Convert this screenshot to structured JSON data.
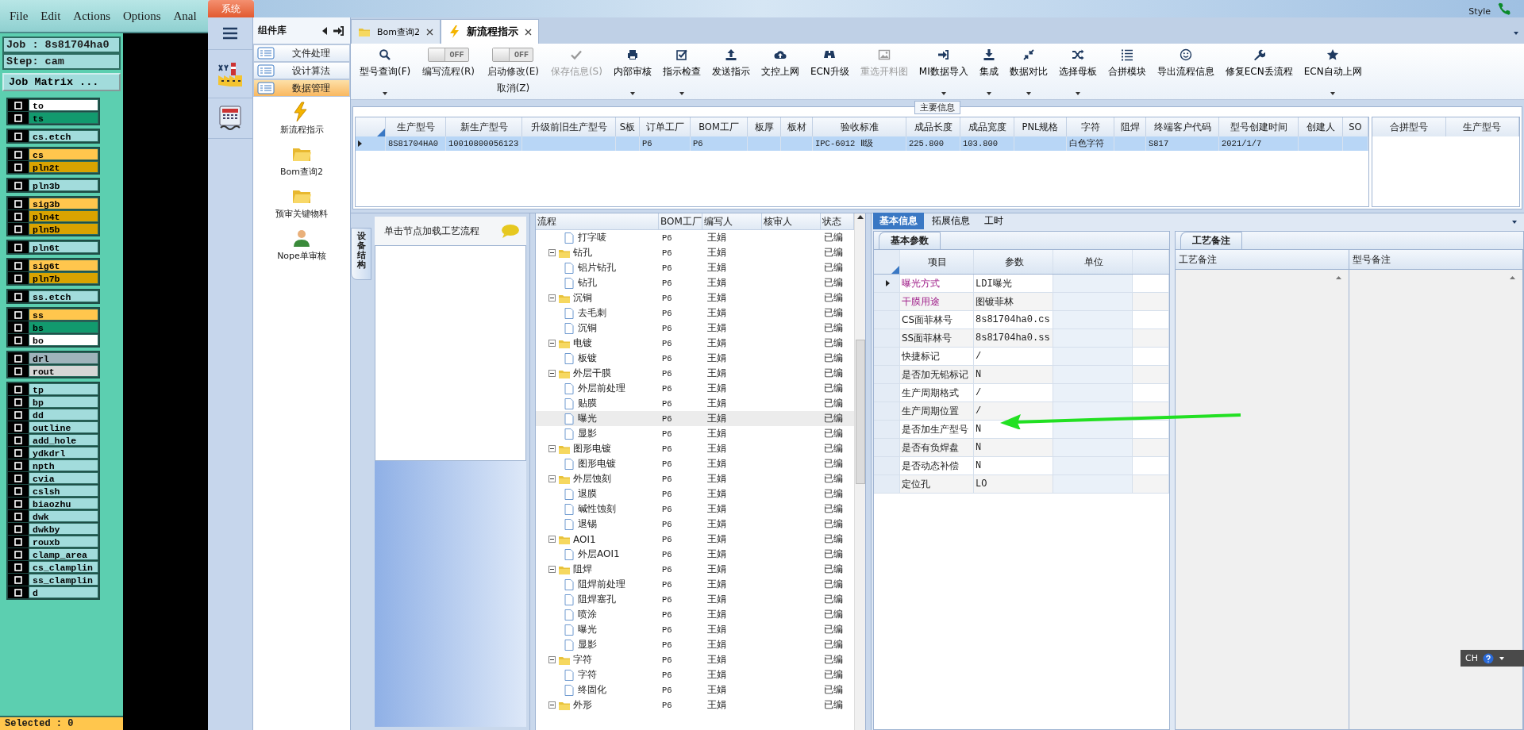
{
  "cam": {
    "menu": [
      "File",
      "Edit",
      "Actions",
      "Options",
      "Anal"
    ],
    "job": "Job : 8s81704ha0",
    "step": "Step: cam",
    "matrix_button": "Job Matrix ...",
    "layer_groups": [
      {
        "layers": [
          {
            "name": "to",
            "color": "#ffffff"
          },
          {
            "name": "ts",
            "color": "#129a6e"
          }
        ]
      },
      {
        "layers": [
          {
            "name": "cs.etch",
            "color": "#a2dcdc"
          }
        ]
      },
      {
        "layers": [
          {
            "name": "cs",
            "color": "#ffc64d"
          },
          {
            "name": "pln2t",
            "color": "#d9a300"
          }
        ]
      },
      {
        "layers": [
          {
            "name": "pln3b",
            "color": "#a2dcdc"
          }
        ]
      },
      {
        "layers": [
          {
            "name": "sig3b",
            "color": "#ffc64d"
          },
          {
            "name": "pln4t",
            "color": "#d9a300"
          },
          {
            "name": "pln5b",
            "color": "#d9a300"
          }
        ]
      },
      {
        "layers": [
          {
            "name": "pln6t",
            "color": "#a2dcdc"
          }
        ]
      },
      {
        "layers": [
          {
            "name": "sig6t",
            "color": "#ffc64d"
          },
          {
            "name": "pln7b",
            "color": "#d9a300"
          }
        ]
      },
      {
        "layers": [
          {
            "name": "ss.etch",
            "color": "#a2dcdc"
          }
        ]
      },
      {
        "layers": [
          {
            "name": "ss",
            "color": "#ffc64d"
          },
          {
            "name": "bs",
            "color": "#129a6e"
          },
          {
            "name": "bo",
            "color": "#ffffff"
          }
        ]
      },
      {
        "layers": [
          {
            "name": "drl",
            "color": "#9fb3bb"
          },
          {
            "name": "rout",
            "color": "#d6d6d6"
          }
        ]
      },
      {
        "layers": [
          {
            "name": "tp",
            "color": "#a2dcdc"
          },
          {
            "name": "bp",
            "color": "#a2dcdc"
          },
          {
            "name": "dd",
            "color": "#a2dcdc"
          },
          {
            "name": "outline",
            "color": "#a2dcdc"
          },
          {
            "name": "add_hole",
            "color": "#a2dcdc"
          },
          {
            "name": "ydkdrl",
            "color": "#a2dcdc"
          },
          {
            "name": "npth",
            "color": "#a2dcdc"
          },
          {
            "name": "cvia",
            "color": "#a2dcdc"
          },
          {
            "name": "cslsh",
            "color": "#a2dcdc"
          },
          {
            "name": "biaozhu",
            "color": "#a2dcdc"
          },
          {
            "name": "dwk",
            "color": "#a2dcdc"
          },
          {
            "name": "dwkby",
            "color": "#a2dcdc"
          },
          {
            "name": "rouxb",
            "color": "#a2dcdc"
          },
          {
            "name": "clamp_area",
            "color": "#a2dcdc"
          },
          {
            "name": "cs_clamplin",
            "color": "#a2dcdc"
          },
          {
            "name": "ss_clamplin",
            "color": "#a2dcdc"
          },
          {
            "name": "d",
            "color": "#a2dcdc"
          }
        ]
      }
    ],
    "status": "Selected : 0"
  },
  "backdrop": {
    "style_menu": "Style"
  },
  "app": {
    "system_tab": "系统",
    "components": {
      "title": "组件库",
      "categories": [
        {
          "label": "文件处理",
          "selected": false
        },
        {
          "label": "设计算法",
          "selected": false
        },
        {
          "label": "数据管理",
          "selected": true
        }
      ],
      "modules": [
        {
          "label": "新流程指示"
        },
        {
          "label": "Bom查询2"
        },
        {
          "label": "预审关键物料"
        },
        {
          "label": "Nope单审核"
        }
      ]
    },
    "tabs": [
      {
        "label": "Bom查询2",
        "selected": false
      },
      {
        "label": "新流程指示",
        "selected": true
      }
    ],
    "toolbar": [
      {
        "kind": "button",
        "label": "型号查询(F)",
        "dropdown": true,
        "disabled": false
      },
      {
        "kind": "toggle",
        "label": "编写流程(R)",
        "state": "OFF",
        "on": false
      },
      {
        "kind": "toggle",
        "label": "启动修改(E)",
        "sublabel": "取消(Z)",
        "state": "OFF",
        "on": false
      },
      {
        "kind": "button",
        "label": "保存信息(S)",
        "dropdown": false,
        "disabled": true
      },
      {
        "kind": "button",
        "label": "内部审核",
        "dropdown": true,
        "disabled": false
      },
      {
        "kind": "button",
        "label": "指示检查",
        "dropdown": true,
        "disabled": false
      },
      {
        "kind": "button",
        "label": "发送指示",
        "dropdown": false,
        "disabled": false
      },
      {
        "kind": "button",
        "label": "文控上网",
        "dropdown": false,
        "disabled": false
      },
      {
        "kind": "button",
        "label": "ECN升级",
        "dropdown": false,
        "disabled": false
      },
      {
        "kind": "button",
        "label": "重选开料图",
        "dropdown": false,
        "disabled": true
      },
      {
        "kind": "button",
        "label": "MI数据导入",
        "dropdown": true,
        "disabled": false
      },
      {
        "kind": "button",
        "label": "集成",
        "dropdown": true,
        "disabled": false
      },
      {
        "kind": "button",
        "label": "数据对比",
        "dropdown": true,
        "disabled": false
      },
      {
        "kind": "button",
        "label": "选择母板",
        "dropdown": true,
        "disabled": false
      },
      {
        "kind": "button",
        "label": "合拼模块",
        "dropdown": false,
        "disabled": false
      },
      {
        "kind": "button",
        "label": "导出流程信息",
        "dropdown": false,
        "disabled": false
      },
      {
        "kind": "button",
        "label": "修复ECN丢流程",
        "dropdown": false,
        "disabled": false
      },
      {
        "kind": "button",
        "label": "ECN自动上网",
        "dropdown": true,
        "disabled": false
      }
    ],
    "main_info": {
      "title": "主要信息",
      "row_selected": true,
      "columns": [
        {
          "label": "生产型号",
          "value": "8S81704HA0"
        },
        {
          "label": "新生产型号",
          "value": "10010800056123"
        },
        {
          "label": "升级前旧生产型号"
        },
        {
          "label": "S板"
        },
        {
          "label": "订单工厂",
          "value": "P6"
        },
        {
          "label": "BOM工厂",
          "value": "P6"
        },
        {
          "label": "板厚"
        },
        {
          "label": "板材"
        },
        {
          "label": "验收标准",
          "value": "IPC-6012 Ⅱ级"
        },
        {
          "label": "成品长度",
          "value": "225.800"
        },
        {
          "label": "成品宽度",
          "value": "103.800"
        },
        {
          "label": "PNL规格"
        },
        {
          "label": "字符",
          "value": "白色字符"
        },
        {
          "label": "阻焊"
        },
        {
          "label": "终端客户代码",
          "value": "S817"
        },
        {
          "label": "型号创建时间",
          "value": "2021/1/7"
        },
        {
          "label": "创建人"
        },
        {
          "label": "SO"
        }
      ],
      "side_columns": [
        "合拼型号",
        "生产型号"
      ]
    },
    "equipment_tab": "设备结构",
    "flow_hint": "单击节点加载工艺流程",
    "flow_tree": {
      "columns": [
        "流程",
        "BOM工厂",
        "编写人",
        "核审人",
        "状态"
      ],
      "nodes": [
        {
          "kind": "file",
          "label": "打字唛",
          "bom": "P6",
          "writer": "王娟",
          "status": "已编",
          "selected": false
        },
        {
          "kind": "folder",
          "label": "钻孔",
          "bom": "P6",
          "writer": "王娟",
          "status": "已编",
          "selected": false,
          "expanded": true,
          "children": [
            {
              "kind": "file",
              "label": "铝片钻孔",
              "bom": "P6",
              "writer": "王娟",
              "status": "已编",
              "selected": false
            },
            {
              "kind": "file",
              "label": "钻孔",
              "bom": "P6",
              "writer": "王娟",
              "status": "已编",
              "selected": false
            }
          ]
        },
        {
          "kind": "folder",
          "label": "沉铜",
          "bom": "P6",
          "writer": "王娟",
          "status": "已编",
          "selected": false,
          "expanded": true,
          "children": [
            {
              "kind": "file",
              "label": "去毛刺",
              "bom": "P6",
              "writer": "王娟",
              "status": "已编",
              "selected": false
            },
            {
              "kind": "file",
              "label": "沉铜",
              "bom": "P6",
              "writer": "王娟",
              "status": "已编",
              "selected": false
            }
          ]
        },
        {
          "kind": "folder",
          "label": "电镀",
          "bom": "P6",
          "writer": "王娟",
          "status": "已编",
          "selected": false,
          "expanded": true,
          "children": [
            {
              "kind": "file",
              "label": "板镀",
              "bom": "P6",
              "writer": "王娟",
              "status": "已编",
              "selected": false
            }
          ]
        },
        {
          "kind": "folder",
          "label": "外层干膜",
          "bom": "P6",
          "writer": "王娟",
          "status": "已编",
          "selected": false,
          "expanded": true,
          "children": [
            {
              "kind": "file",
              "label": "外层前处理",
              "bom": "P6",
              "writer": "王娟",
              "status": "已编",
              "selected": false
            },
            {
              "kind": "file",
              "label": "贴膜",
              "bom": "P6",
              "writer": "王娟",
              "status": "已编",
              "selected": false
            },
            {
              "kind": "file",
              "label": "曝光",
              "bom": "P6",
              "writer": "王娟",
              "status": "已编",
              "selected": true
            },
            {
              "kind": "file",
              "label": "显影",
              "bom": "P6",
              "writer": "王娟",
              "status": "已编",
              "selected": false
            }
          ]
        },
        {
          "kind": "folder",
          "label": "图形电镀",
          "bom": "P6",
          "writer": "王娟",
          "status": "已编",
          "selected": false,
          "expanded": true,
          "children": [
            {
              "kind": "file",
              "label": "图形电镀",
              "bom": "P6",
              "writer": "王娟",
              "status": "已编",
              "selected": false
            }
          ]
        },
        {
          "kind": "folder",
          "label": "外层蚀刻",
          "bom": "P6",
          "writer": "王娟",
          "status": "已编",
          "selected": false,
          "expanded": true,
          "children": [
            {
              "kind": "file",
              "label": "退膜",
              "bom": "P6",
              "writer": "王娟",
              "status": "已编",
              "selected": false
            },
            {
              "kind": "file",
              "label": "碱性蚀刻",
              "bom": "P6",
              "writer": "王娟",
              "status": "已编",
              "selected": false
            },
            {
              "kind": "file",
              "label": "退锡",
              "bom": "P6",
              "writer": "王娟",
              "status": "已编",
              "selected": false
            }
          ]
        },
        {
          "kind": "folder",
          "label": "AOI1",
          "bom": "P6",
          "writer": "王娟",
          "status": "已编",
          "selected": false,
          "expanded": true,
          "children": [
            {
              "kind": "file",
              "label": "外层AOI1",
              "bom": "P6",
              "writer": "王娟",
              "status": "已编",
              "selected": false
            }
          ]
        },
        {
          "kind": "folder",
          "label": "阻焊",
          "bom": "P6",
          "writer": "王娟",
          "status": "已编",
          "selected": false,
          "expanded": true,
          "children": [
            {
              "kind": "file",
              "label": "阻焊前处理",
              "bom": "P6",
              "writer": "王娟",
              "status": "已编",
              "selected": false
            },
            {
              "kind": "file",
              "label": "阻焊塞孔",
              "bom": "P6",
              "writer": "王娟",
              "status": "已编",
              "selected": false
            },
            {
              "kind": "file",
              "label": "喷涂",
              "bom": "P6",
              "writer": "王娟",
              "status": "已编",
              "selected": false
            },
            {
              "kind": "file",
              "label": "曝光",
              "bom": "P6",
              "writer": "王娟",
              "status": "已编",
              "selected": false
            },
            {
              "kind": "file",
              "label": "显影",
              "bom": "P6",
              "writer": "王娟",
              "status": "已编",
              "selected": false
            }
          ]
        },
        {
          "kind": "folder",
          "label": "字符",
          "bom": "P6",
          "writer": "王娟",
          "status": "已编",
          "selected": false,
          "expanded": true,
          "children": [
            {
              "kind": "file",
              "label": "字符",
              "bom": "P6",
              "writer": "王娟",
              "status": "已编",
              "selected": false
            },
            {
              "kind": "file",
              "label": "终固化",
              "bom": "P6",
              "writer": "王娟",
              "status": "已编",
              "selected": false
            }
          ]
        },
        {
          "kind": "folder",
          "label": "外形",
          "bom": "P6",
          "writer": "王娟",
          "status": "已编",
          "selected": false,
          "expanded": true
        }
      ]
    },
    "detail_tabs": [
      {
        "label": "基本信息",
        "selected": true
      },
      {
        "label": "拓展信息",
        "selected": false
      },
      {
        "label": "工时",
        "selected": false
      }
    ],
    "params": {
      "tab": "基本参数",
      "columns": [
        "项目",
        "参数",
        "单位"
      ],
      "rows": [
        {
          "item": "曝光方式",
          "value": "LDI曝光",
          "emphasized": true,
          "selected": true
        },
        {
          "item": "干膜用途",
          "value": "图镀菲林",
          "emphasized": true,
          "selected": false
        },
        {
          "item": "CS面菲林号",
          "value": "8s81704ha0.cs",
          "emphasized": false,
          "selected": false
        },
        {
          "item": "SS面菲林号",
          "value": "8s81704ha0.ss",
          "emphasized": false,
          "selected": false
        },
        {
          "item": "快捷标记",
          "value": "/",
          "emphasized": false,
          "selected": false
        },
        {
          "item": "是否加无铅标记",
          "value": "N",
          "emphasized": false,
          "selected": false
        },
        {
          "item": "生产周期格式",
          "value": "/",
          "emphasized": false,
          "selected": false
        },
        {
          "item": "生产周期位置",
          "value": "/",
          "emphasized": false,
          "selected": false
        },
        {
          "item": "是否加生产型号",
          "value": "N",
          "emphasized": false,
          "selected": false
        },
        {
          "item": "是否有负焊盘",
          "value": "N",
          "emphasized": false,
          "selected": false
        },
        {
          "item": "是否动态补偿",
          "value": "N",
          "emphasized": false,
          "selected": false
        },
        {
          "item": "定位孔",
          "value": "LO",
          "emphasized": false,
          "selected": false
        }
      ]
    },
    "notes": {
      "tab": "工艺备注",
      "columns": [
        "工艺备注",
        "型号备注"
      ]
    }
  },
  "ime": {
    "label": "CH"
  }
}
